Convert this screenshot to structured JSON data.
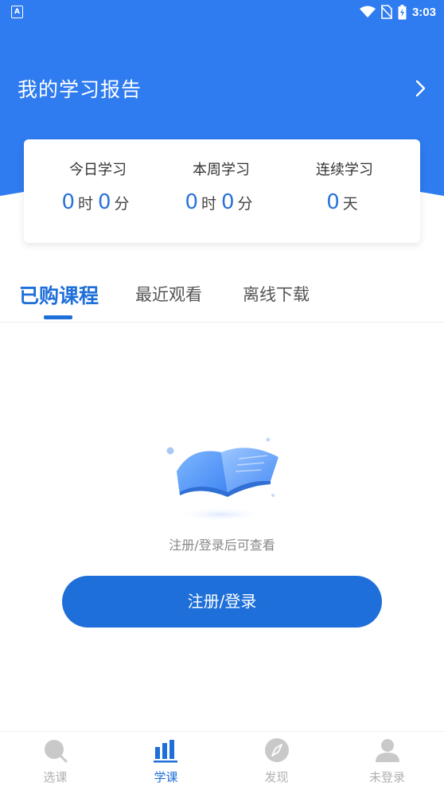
{
  "status_bar": {
    "app_icon_letter": "A",
    "time": "3:03"
  },
  "report": {
    "title": "我的学习报告"
  },
  "stats": [
    {
      "label": "今日学习",
      "value1": "0",
      "unit1": "时",
      "value2": "0",
      "unit2": "分"
    },
    {
      "label": "本周学习",
      "value1": "0",
      "unit1": "时",
      "value2": "0",
      "unit2": "分"
    },
    {
      "label": "连续学习",
      "value1": "0",
      "unit1": "天"
    }
  ],
  "tabs": [
    {
      "label": "已购课程",
      "active": true
    },
    {
      "label": "最近观看",
      "active": false
    },
    {
      "label": "离线下载",
      "active": false
    }
  ],
  "empty_state": {
    "message": "注册/登录后可查看",
    "button_label": "注册/登录"
  },
  "bottom_nav": [
    {
      "label": "选课",
      "icon": "search-icon",
      "active": false
    },
    {
      "label": "学课",
      "icon": "bar-chart-icon",
      "active": true
    },
    {
      "label": "发现",
      "icon": "compass-icon",
      "active": false
    },
    {
      "label": "未登录",
      "icon": "user-icon",
      "active": false
    }
  ],
  "colors": {
    "primary": "#1e6fd9",
    "header": "#2f7bf0",
    "nav_inactive": "#b0b0b0"
  }
}
